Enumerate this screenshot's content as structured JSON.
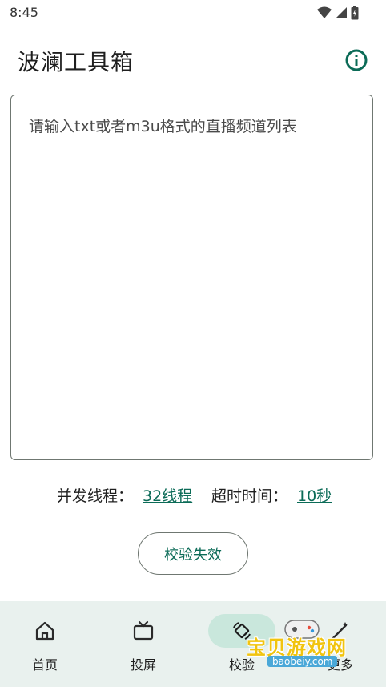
{
  "status_bar": {
    "time": "8:45",
    "icons": [
      "wifi-icon",
      "signal-icon",
      "battery-icon"
    ]
  },
  "app_bar": {
    "title": "波澜工具箱",
    "info_icon": "info-icon"
  },
  "editor": {
    "placeholder": "请输入txt或者m3u格式的直播频道列表",
    "value": ""
  },
  "settings": {
    "threads_label": "并发线程：",
    "threads_value": "32线程",
    "timeout_label": "超时时间：",
    "timeout_value": "10秒"
  },
  "action": {
    "label": "校验失效"
  },
  "bottom_nav": {
    "items": [
      {
        "label": "首页",
        "icon": "home-icon",
        "active": false
      },
      {
        "label": "投屏",
        "icon": "tv-icon",
        "active": false
      },
      {
        "label": "校验",
        "icon": "rotate-icon",
        "active": true
      },
      {
        "label": "更多",
        "icon": "magic-wand-icon",
        "active": false
      }
    ]
  },
  "watermark": {
    "text": "宝贝游戏网",
    "sub": "baobeiy.com"
  },
  "colors": {
    "accent": "#0b6b57",
    "nav_background": "#e9f1ee",
    "nav_active_pill": "#c9e7dc",
    "outline": "#6f7771"
  }
}
